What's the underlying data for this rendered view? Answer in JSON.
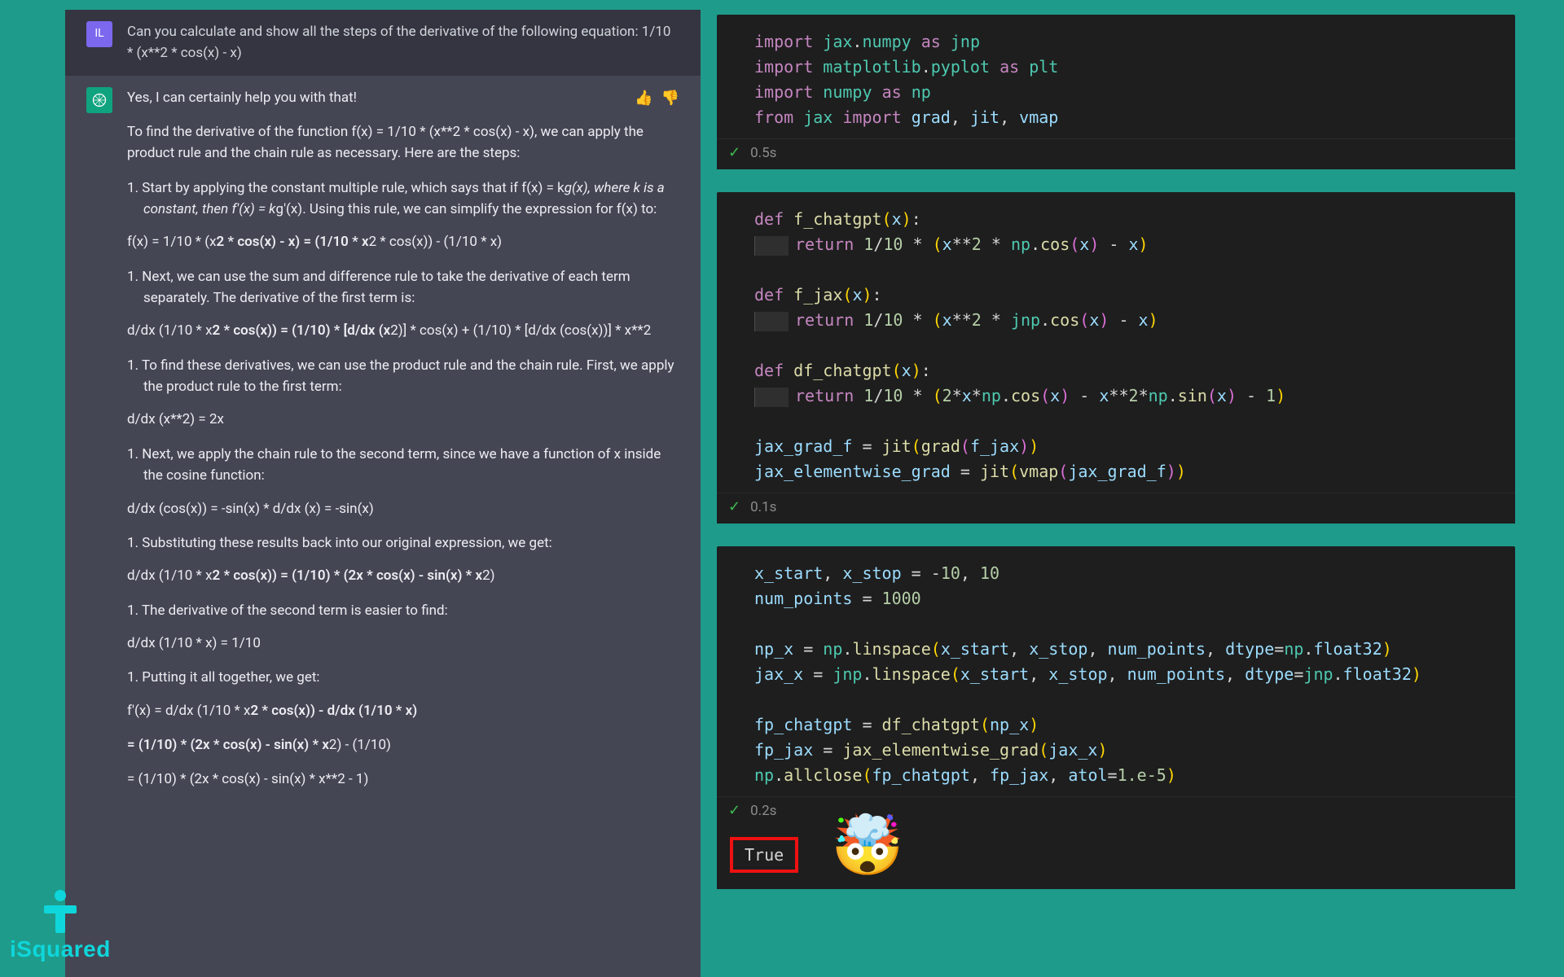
{
  "chat": {
    "user_avatar": "IL",
    "user_prompt": "Can you calculate and show all the steps of the derivative of the following equation: 1/10 * (x**2 * cos(x) - x)",
    "assistant_intro": "Yes, I can certainly help you with that!",
    "assistant_lead": "To find the derivative of the function f(x) = 1/10 * (x**2 * cos(x) - x), we can apply the product rule and the chain rule as necessary. Here are the steps:",
    "steps": [
      "Start by applying the constant multiple rule, which says that if f(x) = kg(x), where k is a constant, then f'(x) = kg'(x). Using this rule, we can simplify the expression for f(x) to:",
      "Next, we can use the sum and difference rule to take the derivative of each term separately. The derivative of the first term is:",
      "To find these derivatives, we can use the product rule and the chain rule. First, we apply the product rule to the first term:",
      "Next, we apply the chain rule to the second term, since we have a function of x inside the cosine function:",
      "Substituting these results back into our original expression, we get:",
      "The derivative of the second term is easier to find:",
      "Putting it all together, we get:"
    ],
    "equations": {
      "e1": "f(x) = 1/10 * (x2 * cos(x) - x) = (1/10 * x2 * cos(x)) - (1/10 * x)",
      "e2": "d/dx (1/10 * x2 * cos(x)) = (1/10) * [d/dx (x2)] * cos(x) + (1/10) * [d/dx (cos(x))] * x**2",
      "e3": "d/dx (x**2) = 2x",
      "e4": "d/dx (cos(x)) = -sin(x) * d/dx (x) = -sin(x)",
      "e5": "d/dx (1/10 * x2 * cos(x)) = (1/10) * (2x * cos(x) - sin(x) * x2)",
      "e6": "d/dx (1/10 * x) = 1/10",
      "e7a": "f'(x) = d/dx (1/10 * x2 * cos(x)) - d/dx (1/10 * x)",
      "e7b": "= (1/10) * (2x * cos(x) - sin(x) * x2) - (1/10)",
      "e7c": "= (1/10) * (2x * cos(x) - sin(x) * x**2 - 1)"
    }
  },
  "code": {
    "cell1_time": "0.5s",
    "cell2_time": "0.1s",
    "cell3_time": "0.2s",
    "output_value": "True",
    "emoji": "🤯"
  },
  "watermark": "iSquared"
}
